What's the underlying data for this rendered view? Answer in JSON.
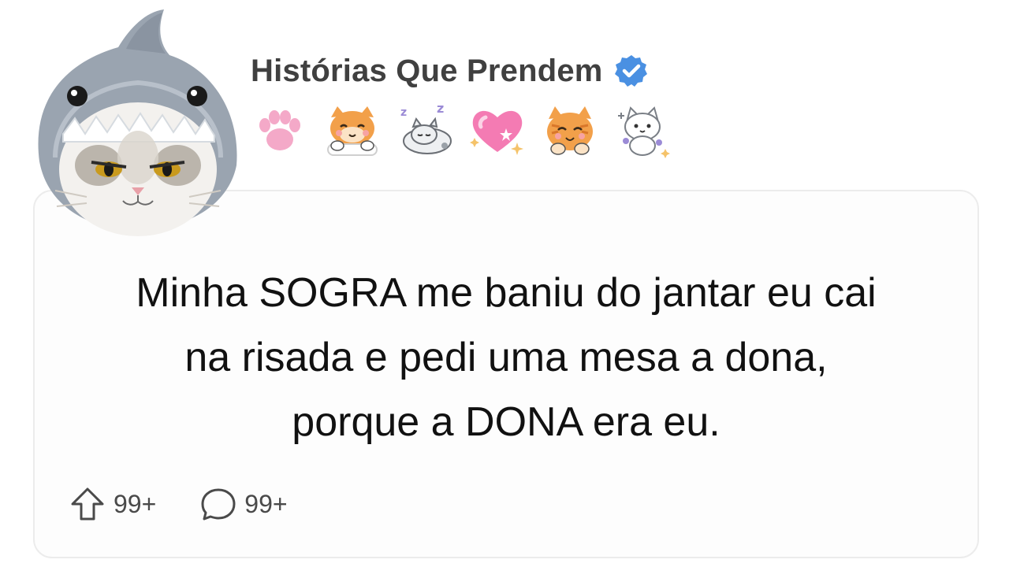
{
  "channel": {
    "name": "Histórias Que Prendem",
    "verified": true,
    "avatar": "cat-in-shark-hat",
    "accent": "#4a90e2"
  },
  "emoji_row": [
    "paw-emoji",
    "cat-hands-emoji",
    "sleeping-cat-emoji",
    "pink-heart-emoji",
    "smiling-cat-emoji",
    "white-cat-emoji"
  ],
  "post": {
    "lines": [
      "Minha SOGRA me baniu do jantar eu cai",
      "na risada e pedi uma mesa a dona,",
      "porque a DONA era eu."
    ]
  },
  "actions": {
    "upvotes": "99+",
    "comments": "99+"
  }
}
